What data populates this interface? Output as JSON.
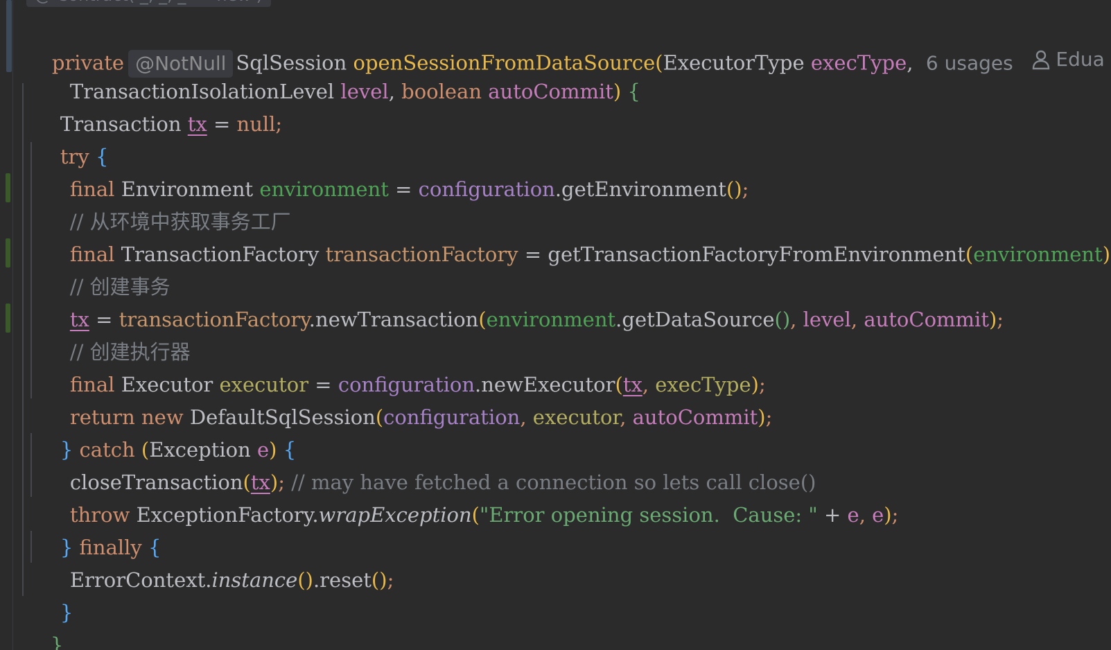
{
  "editor": {
    "top_fragment": "@ Contract( _, _, _ -> new )",
    "inlay": {
      "annotation": "@NotNull",
      "usages": "6 usages",
      "author": "Edua"
    },
    "colors": {
      "background": "#2b2b2b",
      "keyword": "#cf8e6d",
      "method_decl": "#e8b94a",
      "field": "#a782c9",
      "parameter": "#c77dbb",
      "local_var": "#4fa356",
      "string": "#6aab73",
      "comment": "#7a7e85",
      "gutter_change": "#3a5a2a"
    },
    "lines": [
      {
        "id": "l1",
        "tokens": [
          "private",
          "SqlSession",
          "openSessionFromDataSource",
          "(",
          "ExecutorType",
          "execType",
          ","
        ]
      },
      {
        "id": "l2",
        "tokens": [
          "TransactionIsolationLevel",
          "level",
          ",",
          "boolean",
          "autoCommit",
          ")",
          "{"
        ]
      },
      {
        "id": "l3",
        "tokens": [
          "Transaction",
          "tx",
          "=",
          "null",
          ";"
        ]
      },
      {
        "id": "l4",
        "tokens": [
          "try",
          "{"
        ]
      },
      {
        "id": "l5",
        "tokens": [
          "final",
          "Environment",
          "environment",
          "=",
          "configuration",
          ".getEnvironment",
          "()",
          ";"
        ]
      },
      {
        "id": "l6",
        "tokens": [
          "// 从环境中获取事务工厂"
        ]
      },
      {
        "id": "l7",
        "tokens": [
          "final",
          "TransactionFactory",
          "transactionFactory",
          "=",
          "getTransactionFactoryFromEnvironment",
          "(",
          "environment",
          ")",
          ";"
        ]
      },
      {
        "id": "l8",
        "tokens": [
          "// 创建事务"
        ]
      },
      {
        "id": "l9",
        "tokens": [
          "tx",
          "=",
          "transactionFactory",
          ".newTransaction",
          "(",
          "environment",
          ".getDataSource",
          "()",
          ",",
          "level",
          ",",
          "autoCommit",
          ")",
          ";"
        ]
      },
      {
        "id": "l10",
        "tokens": [
          "// 创建执行器"
        ]
      },
      {
        "id": "l11",
        "tokens": [
          "final",
          "Executor",
          "executor",
          "=",
          "configuration",
          ".newExecutor",
          "(",
          "tx",
          ",",
          "execType",
          ")",
          ";"
        ]
      },
      {
        "id": "l12",
        "tokens": [
          "return",
          "new",
          "DefaultSqlSession",
          "(",
          "configuration",
          ",",
          "executor",
          ",",
          "autoCommit",
          ")",
          ";"
        ]
      },
      {
        "id": "l13",
        "tokens": [
          "}",
          "catch",
          "(",
          "Exception",
          "e",
          ")",
          "{"
        ]
      },
      {
        "id": "l14",
        "tokens": [
          "closeTransaction",
          "(",
          "tx",
          ")",
          ";",
          "// may have fetched a connection so lets call close()"
        ]
      },
      {
        "id": "l15",
        "tokens": [
          "throw",
          "ExceptionFactory",
          ".",
          "wrapException",
          "(",
          "\"Error opening session.  Cause: \"",
          "+",
          "e",
          ",",
          "e",
          ")",
          ";"
        ]
      },
      {
        "id": "l16",
        "tokens": [
          "}",
          "finally",
          "{"
        ]
      },
      {
        "id": "l17",
        "tokens": [
          "ErrorContext",
          ".",
          "instance",
          "()",
          ".reset",
          "()",
          ";"
        ]
      },
      {
        "id": "l18",
        "tokens": [
          "}"
        ]
      },
      {
        "id": "l19",
        "tokens": [
          "}"
        ]
      }
    ]
  }
}
